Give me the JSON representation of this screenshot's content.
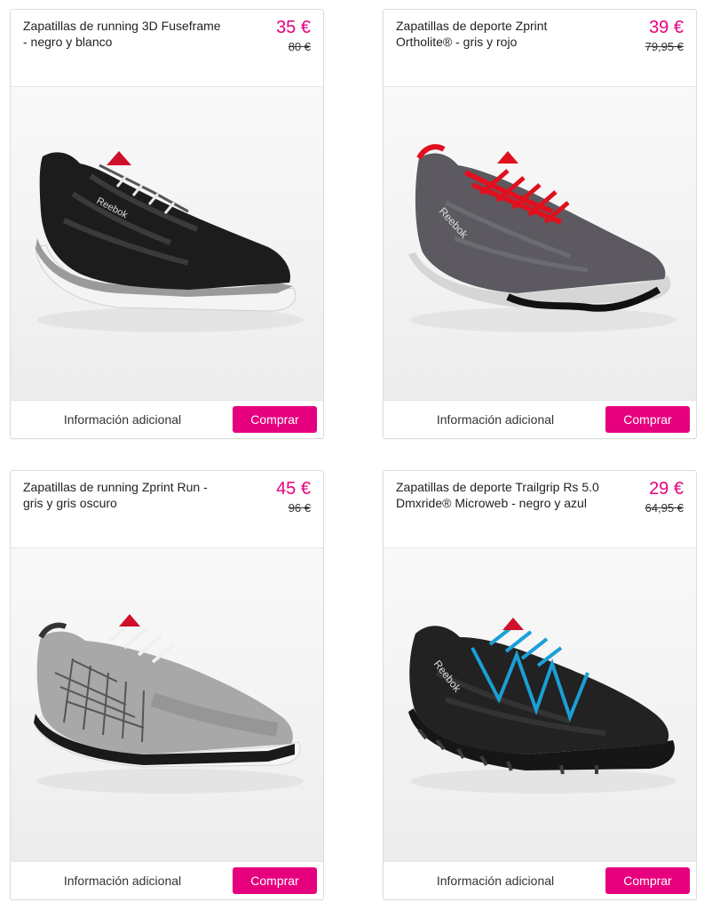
{
  "colors": {
    "accent": "#e6007e",
    "border": "#dcdcdc"
  },
  "products": [
    {
      "title": "Zapatillas de running 3D Fuseframe - negro y blanco",
      "price": "35 €",
      "old_price": "80 €",
      "info_label": "Información adicional",
      "buy_label": "Comprar",
      "image": "black-white-running-shoe"
    },
    {
      "title": "Zapatillas de deporte Zprint Ortholite® - gris y rojo",
      "price": "39 €",
      "old_price": "79,95 €",
      "info_label": "Información adicional",
      "buy_label": "Comprar",
      "image": "grey-red-sport-shoe"
    },
    {
      "title": "Zapatillas de running Zprint Run - gris y gris oscuro",
      "price": "45 €",
      "old_price": "96 €",
      "info_label": "Información adicional",
      "buy_label": "Comprar",
      "image": "light-grey-running-shoe"
    },
    {
      "title": "Zapatillas de deporte Trailgrip Rs 5.0 Dmxride® Microweb - negro y azul",
      "price": "29 €",
      "old_price": "64,95 €",
      "info_label": "Información adicional",
      "buy_label": "Comprar",
      "image": "black-blue-trail-shoe"
    }
  ]
}
